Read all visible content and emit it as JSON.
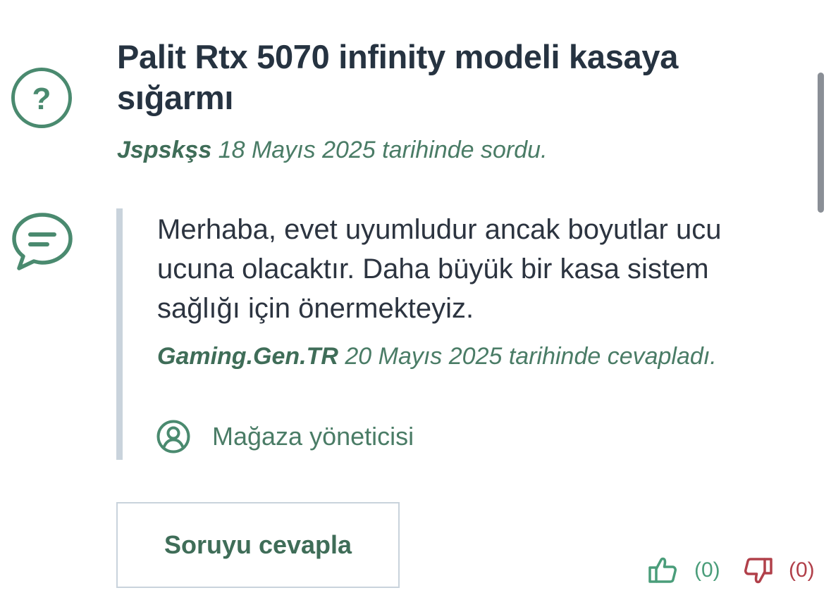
{
  "question": {
    "icon": "question-circle-icon",
    "title": "Palit Rtx 5070 infinity modeli kasaya sığarmı",
    "author": "Jspskşs",
    "meta_suffix": " 18 Mayıs 2025 tarihinde sordu."
  },
  "answer": {
    "icon": "chat-bubble-icon",
    "text": "Merhaba, evet uyumludur ancak boyutlar ucu ucuna olacaktır. Daha büyük bir kasa sistem sağlığı için önermekteyiz.",
    "author": "Gaming.Gen.TR",
    "meta_suffix": " 20 Mayıs 2025 tarihinde cevapladı.",
    "role_icon": "user-circle-icon",
    "role_label": "Mağaza yöneticisi"
  },
  "actions": {
    "answer_button_label": "Soruyu cevapla",
    "upvote_icon": "thumbs-up-icon",
    "upvote_count": "(0)",
    "downvote_icon": "thumbs-down-icon",
    "downvote_count": "(0)"
  },
  "colors": {
    "accent_green": "#4a7c66",
    "title_text": "#263341",
    "downvote_red": "#b1404a",
    "divider": "#c9d3dc"
  }
}
